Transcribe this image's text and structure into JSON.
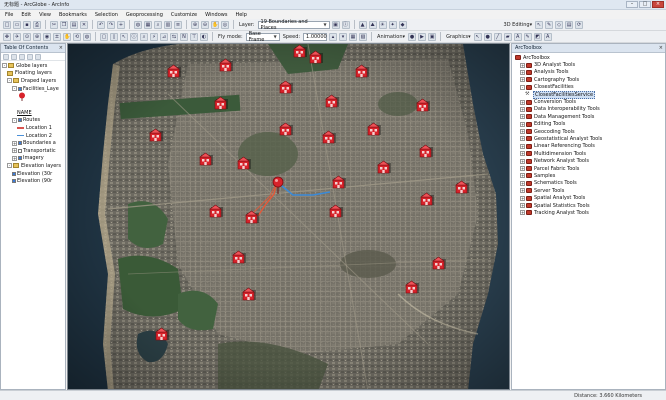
{
  "window": {
    "title": "无标题 - ArcGlobe - ArcInfo"
  },
  "menu": [
    "File",
    "Edit",
    "View",
    "Bookmarks",
    "Selection",
    "Geoprocessing",
    "Customize",
    "Windows",
    "Help"
  ],
  "toolbar1": {
    "layer_label": "Layer:",
    "layer_value": "19 Boundaries and Places",
    "editing_label": "3D Editing▾"
  },
  "toolbar2": {
    "mode_label": "Fly mode:",
    "mode_value": "Base Frame",
    "speed_label": "Speed:",
    "speed_value": "1.00000",
    "animation_label": "Animation▾",
    "graphics_label": "Graphics▾"
  },
  "toc": {
    "title": "Table Of Contents",
    "items": [
      {
        "label": "Globe layers",
        "indent": 0,
        "exp": "-",
        "type": "group"
      },
      {
        "label": "Floating layers",
        "indent": 1,
        "type": "folder"
      },
      {
        "label": "Draped layers",
        "indent": 1,
        "exp": "-",
        "type": "group"
      },
      {
        "label": "Facilities_Laye",
        "indent": 2,
        "exp": "-",
        "check": true
      },
      {
        "label": "",
        "indent": 3,
        "type": "pin"
      },
      {
        "label": "",
        "indent": 2,
        "type": "spacer"
      },
      {
        "label": "NAME",
        "indent": 3,
        "type": "underline"
      },
      {
        "label": "Routes",
        "indent": 2,
        "exp": "-",
        "check": true
      },
      {
        "label": "Location 1",
        "indent": 3,
        "type": "line",
        "color": "#d9534f"
      },
      {
        "label": "Location 2",
        "indent": 3,
        "type": "line",
        "color": "#4a90d9"
      },
      {
        "label": "Boundaries a",
        "indent": 2,
        "exp": "+",
        "check": true
      },
      {
        "label": "Transportatic",
        "indent": 2,
        "exp": "+",
        "check": false
      },
      {
        "label": "Imagery",
        "indent": 2,
        "exp": "+",
        "check": true
      },
      {
        "label": "Elevation layers",
        "indent": 1,
        "exp": "-",
        "type": "group"
      },
      {
        "label": "Elevation (30r",
        "indent": 2,
        "check": true
      },
      {
        "label": "Elevation (90r",
        "indent": 2,
        "check": true
      }
    ]
  },
  "toolbox": {
    "title": "ArcToolbox",
    "items": [
      {
        "label": "ArcToolbox",
        "indent": 0,
        "type": "root"
      },
      {
        "label": "3D Analyst Tools",
        "indent": 1
      },
      {
        "label": "Analysis Tools",
        "indent": 1
      },
      {
        "label": "Cartography Tools",
        "indent": 1
      },
      {
        "label": "ClosestFacilities",
        "indent": 1,
        "exp": "-"
      },
      {
        "label": "ClosestFacilitiesService",
        "indent": 2,
        "type": "tool",
        "highlight": true
      },
      {
        "label": "Conversion Tools",
        "indent": 1
      },
      {
        "label": "Data Interoperability Tools",
        "indent": 1
      },
      {
        "label": "Data Management Tools",
        "indent": 1
      },
      {
        "label": "Editing Tools",
        "indent": 1
      },
      {
        "label": "Geocoding Tools",
        "indent": 1
      },
      {
        "label": "Geostatistical Analyst Tools",
        "indent": 1
      },
      {
        "label": "Linear Referencing Tools",
        "indent": 1
      },
      {
        "label": "Multidimension Tools",
        "indent": 1
      },
      {
        "label": "Network Analyst Tools",
        "indent": 1
      },
      {
        "label": "Parcel Fabric Tools",
        "indent": 1
      },
      {
        "label": "Samples",
        "indent": 1
      },
      {
        "label": "Schematics Tools",
        "indent": 1
      },
      {
        "label": "Server Tools",
        "indent": 1
      },
      {
        "label": "Spatial Analyst Tools",
        "indent": 1
      },
      {
        "label": "Spatial Statistics Tools",
        "indent": 1
      },
      {
        "label": "Tracking Analyst Tools",
        "indent": 1
      }
    ]
  },
  "status": {
    "distance_label": "Distance:",
    "distance_value": "3.660 Kilometers"
  },
  "colors": {
    "facility_red": "#d8222a",
    "route_red": "#e05a3a",
    "route_blue": "#3a8ad8",
    "panel_head": "#dbe4ef"
  }
}
